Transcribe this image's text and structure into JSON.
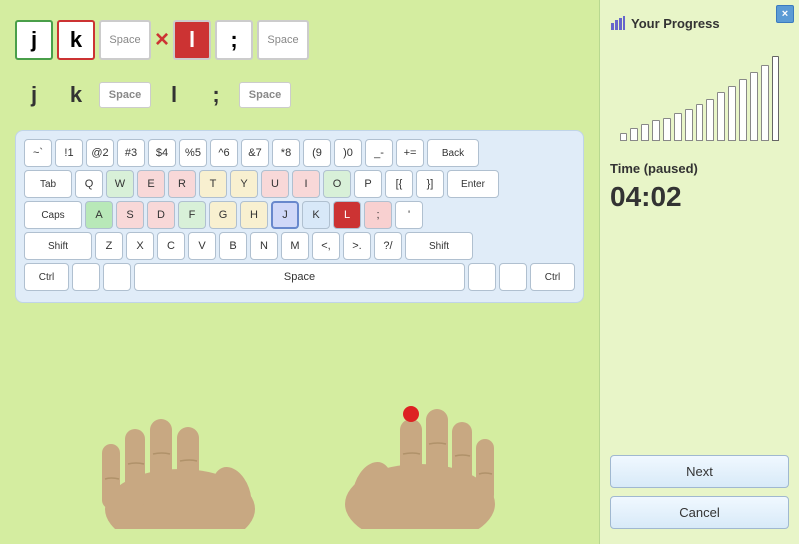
{
  "app": {
    "close_btn": "×"
  },
  "word_display": {
    "row1": [
      {
        "char": "j",
        "style": "green-border"
      },
      {
        "char": "k",
        "style": "red-border"
      },
      {
        "char": "Space",
        "style": "small-text"
      },
      {
        "char": "×",
        "style": "x-mark"
      },
      {
        "char": "l",
        "style": "red-bg"
      },
      {
        "char": ";",
        "style": "plain"
      },
      {
        "char": "Space",
        "style": "small-text space-btn"
      }
    ],
    "row2": [
      {
        "char": "j",
        "style": "plain"
      },
      {
        "char": "k",
        "style": "plain"
      },
      {
        "char": "Space",
        "style": "space-box"
      },
      {
        "char": "l",
        "style": "plain"
      },
      {
        "char": ";",
        "style": "plain"
      },
      {
        "char": "Space",
        "style": "space-box"
      }
    ]
  },
  "keyboard": {
    "row1": [
      "~\n`",
      "!\n1",
      "@\n2",
      "#\n3",
      "$\n4",
      "%\n5",
      "^\n6",
      "&\n7",
      "*\n8",
      "(\n9",
      ")\n0",
      "_\n-",
      "+\n=",
      "Back"
    ],
    "row2": [
      "Tab",
      "Q",
      "W",
      "E",
      "R",
      "T",
      "Y",
      "U",
      "I",
      "O",
      "P",
      "{\n[",
      "}\n]",
      "Enter"
    ],
    "row3": [
      "Caps",
      "A",
      "S",
      "D",
      "F",
      "G",
      "H",
      "J",
      "K",
      "L",
      ";",
      "'"
    ],
    "row4": [
      "Shift",
      "Z",
      "X",
      "C",
      "V",
      "B",
      "N",
      "M",
      "<\n,",
      ">\n.",
      "?\n/",
      "Shift"
    ],
    "row5": [
      "Ctrl",
      "",
      "",
      "Space",
      "",
      "",
      "Ctrl"
    ]
  },
  "sidebar": {
    "progress_title": "Your Progress",
    "chart_bars": [
      8,
      12,
      16,
      20,
      22,
      26,
      30,
      35,
      40,
      46,
      52,
      58,
      65,
      72,
      80
    ],
    "time_label": "Time (paused)",
    "time_value": "04:02",
    "next_btn": "Next",
    "cancel_btn": "Cancel"
  }
}
